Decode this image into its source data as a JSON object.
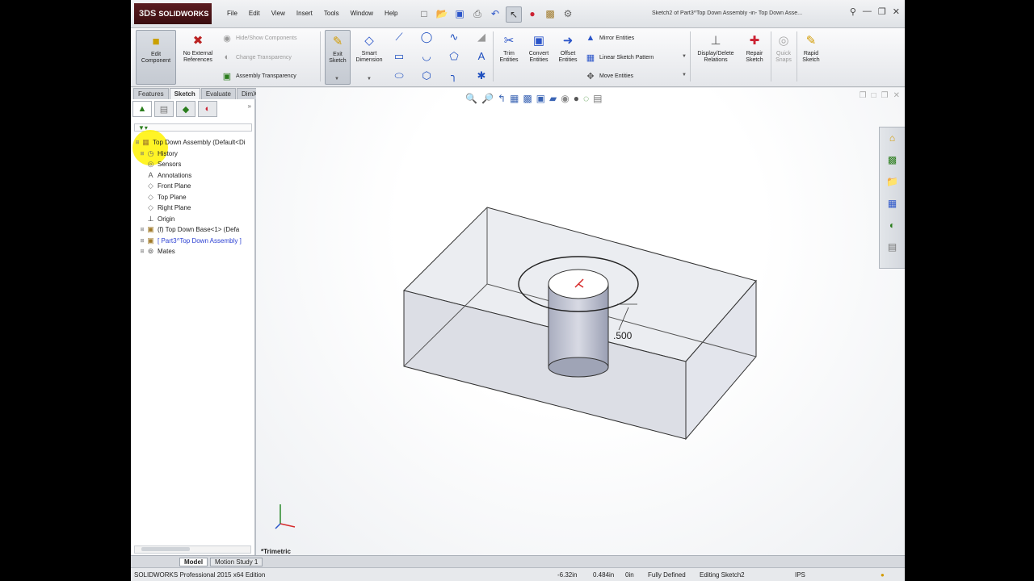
{
  "app": {
    "logo_ds": "3DS",
    "logo_text": "SOLIDWORKS",
    "doc_title": "Sketch2 of Part3^Top Down Assembly -in- Top Down Asse...",
    "menus": [
      "File",
      "Edit",
      "View",
      "Insert",
      "Tools",
      "Window",
      "Help"
    ]
  },
  "command_manager": {
    "edit_component": "Edit Component",
    "no_external_references": "No External References",
    "hide_show_components": "Hide/Show Components",
    "change_transparency": "Change Transparency",
    "assembly_transparency": "Assembly Transparency",
    "exit_sketch": "Exit Sketch",
    "smart_dimension": "Smart Dimension",
    "trim_entities": "Trim Entities",
    "convert_entities": "Convert Entities",
    "offset_entities": "Offset Entities",
    "mirror_entities": "Mirror Entities",
    "linear_sketch_pattern": "Linear Sketch Pattern",
    "move_entities": "Move Entities",
    "display_delete_relations": "Display/Delete Relations",
    "repair_sketch": "Repair Sketch",
    "quick_snaps": "Quick Snaps",
    "rapid_sketch": "Rapid Sketch"
  },
  "tabs": [
    "Features",
    "Sketch",
    "Evaluate",
    "DimXpert"
  ],
  "active_tab": "Sketch",
  "tree": {
    "filter": "▼▾",
    "nodes": [
      {
        "label": "Top Down Assembly  (Default<Di",
        "icon": "assembly-icon",
        "indent": 0,
        "blue": false
      },
      {
        "label": "History",
        "icon": "history-icon",
        "indent": 1,
        "blue": false
      },
      {
        "label": "Sensors",
        "icon": "sensor-icon",
        "indent": 1,
        "blue": false
      },
      {
        "label": "Annotations",
        "icon": "annotation-icon",
        "indent": 1,
        "blue": false
      },
      {
        "label": "Front Plane",
        "icon": "plane-icon",
        "indent": 1,
        "blue": false
      },
      {
        "label": "Top Plane",
        "icon": "plane-icon",
        "indent": 1,
        "blue": false
      },
      {
        "label": "Right Plane",
        "icon": "plane-icon",
        "indent": 1,
        "blue": false
      },
      {
        "label": "Origin",
        "icon": "origin-icon",
        "indent": 1,
        "blue": false
      },
      {
        "label": "(f) Top Down Base<1> (Defa",
        "icon": "part-icon",
        "indent": 1,
        "blue": false
      },
      {
        "label": "[ Part3^Top Down Assembly ]",
        "icon": "part-icon",
        "indent": 1,
        "blue": true
      },
      {
        "label": "Mates",
        "icon": "mates-icon",
        "indent": 1,
        "blue": false
      }
    ]
  },
  "viewport": {
    "dimension": ".500",
    "view_label": "*Trimetric"
  },
  "bottom_tabs": [
    "Model",
    "Motion Study 1"
  ],
  "status": {
    "edition": "SOLIDWORKS Professional 2015 x64 Edition",
    "x": "-6.32in",
    "y": "0.484in",
    "z": "0in",
    "state": "Fully Defined",
    "editing": "Editing Sketch2",
    "units": "IPS"
  }
}
